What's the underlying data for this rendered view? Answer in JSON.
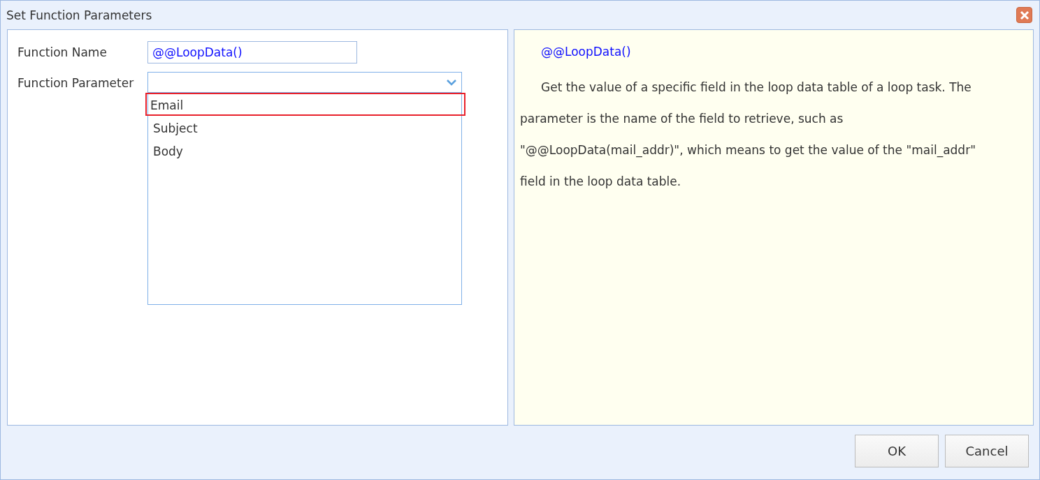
{
  "window": {
    "title": "Set Function Parameters"
  },
  "form": {
    "name_label": "Function Name",
    "name_value": "@@LoopData()",
    "param_label": "Function Parameter",
    "expanded": true,
    "options": [
      {
        "label": "Email",
        "highlighted": true
      },
      {
        "label": "Subject",
        "highlighted": false
      },
      {
        "label": "Body",
        "highlighted": false
      }
    ]
  },
  "help": {
    "title": "@@LoopData()",
    "text": "Get the value of a specific field in the loop data table of a loop task. The parameter is the name of the field to retrieve, such as \"@@LoopData(mail_addr)\", which means to get the value of the \"mail_addr\" field in the loop data table."
  },
  "buttons": [
    "OK",
    "Cancel"
  ]
}
